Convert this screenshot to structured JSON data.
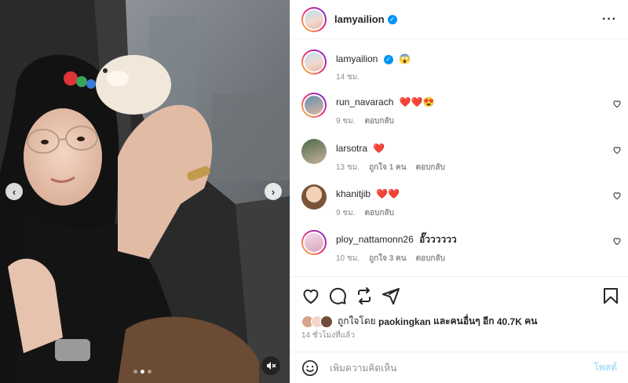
{
  "post": {
    "author": "lamyailion",
    "verified": true,
    "caption_emoji": "😱"
  },
  "caption": {
    "user": "lamyailion",
    "time": "14 ชม."
  },
  "comments": [
    {
      "user": "run_navarach",
      "text": "❤️❤️😍",
      "time": "9 ชม.",
      "likes": "",
      "reply": "ตอบกลับ"
    },
    {
      "user": "larsotra",
      "text": "❤️",
      "time": "13 ชม.",
      "likes": "ถูกใจ 1 คน",
      "reply": "ตอบกลับ"
    },
    {
      "user": "khanitjib",
      "text": "❤️❤️",
      "time": "9 ชม.",
      "likes": "",
      "reply": "ตอบกลับ"
    },
    {
      "user": "ploy_nattamonn26",
      "text": "อั๊วววววว",
      "time": "10 ชม.",
      "likes": "ถูกใจ 3 คน",
      "reply": "ตอบกลับ"
    }
  ],
  "likes": {
    "prefix": "ถูกใจโดย",
    "user": "paokingkan",
    "middle": "และคนอื่นๆ อีก",
    "count": "40.7K",
    "suffix": "คน"
  },
  "timestamp": "14 ชั่วโมงที่แล้ว",
  "composer": {
    "placeholder": "เพิ่มความคิดเห็น",
    "post_label": "โพสต์"
  },
  "carousel": {
    "prev_glyph": "‹",
    "next_glyph": "›",
    "slides": 3,
    "active_slide": 2
  },
  "icons": {
    "header": "more-options-icon",
    "actions": [
      "heart-icon",
      "comment-icon",
      "share-icon",
      "send-icon",
      "bookmark-icon"
    ],
    "composer": "emoji-icon",
    "media": "muted-icon"
  },
  "colors": {
    "verified": "#0095f6",
    "heart_red": "#ed4956",
    "post_button": "#b2dffc",
    "muted_text": "#8e8e8e"
  }
}
